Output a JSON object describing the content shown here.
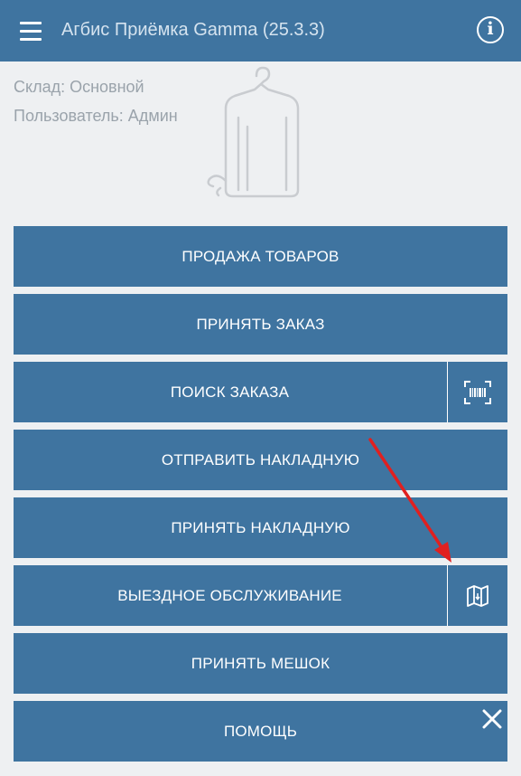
{
  "app": {
    "title": "Агбис Приёмка Gamma (25.3.3)",
    "bar_color": "#3f74a0"
  },
  "header": {
    "menu_icon": "hamburger-menu-icon",
    "info_icon": "info-icon",
    "info_glyph": "i"
  },
  "meta": {
    "warehouse": "Склад: Основной",
    "user": "Пользователь: Админ"
  },
  "menu": {
    "sales": "ПРОДАЖА ТОВАРОВ",
    "accept_order": "ПРИНЯТЬ ЗАКАЗ",
    "search_order": "ПОИСК ЗАКАЗА",
    "send_invoice": "ОТПРАВИТЬ НАКЛАДНУЮ",
    "accept_invoice": "ПРИНЯТЬ НАКЛАДНУЮ",
    "field_service": "ВЫЕЗДНОЕ ОБСЛУЖИВАНИЕ",
    "accept_bag": "ПРИНЯТЬ МЕШОК",
    "help": "ПОМОЩЬ"
  },
  "icons": {
    "barcode_scan": "barcode-scan-icon",
    "map": "map-icon",
    "close": "close-icon",
    "annotation_arrow": "red-arrow-annotation"
  },
  "colors": {
    "button": "#3f74a0",
    "background": "#eef0f2",
    "annotation": "#e02020"
  }
}
